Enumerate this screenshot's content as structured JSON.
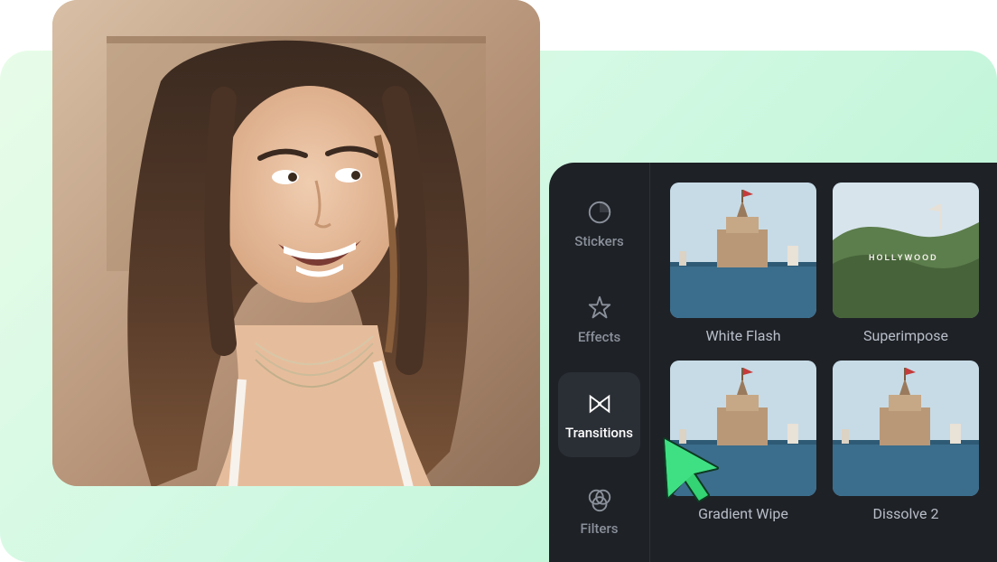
{
  "nav": {
    "items": [
      {
        "key": "stickers",
        "label": "Stickers",
        "active": false
      },
      {
        "key": "effects",
        "label": "Effects",
        "active": false
      },
      {
        "key": "transitions",
        "label": "Transitions",
        "active": true
      },
      {
        "key": "filters",
        "label": "Filters",
        "active": false
      }
    ]
  },
  "tiles": [
    {
      "key": "white-flash",
      "label": "White Flash",
      "variant": "tower"
    },
    {
      "key": "superimpose",
      "label": "Superimpose",
      "variant": "hollywood"
    },
    {
      "key": "gradient-wipe",
      "label": "Gradient Wipe",
      "variant": "tower"
    },
    {
      "key": "dissolve-2",
      "label": "Dissolve 2",
      "variant": "tower"
    }
  ],
  "hollywood_text": "HOLLYWOOD",
  "colors": {
    "panel_bg": "#1e2126",
    "accent_green": "#34d373"
  }
}
